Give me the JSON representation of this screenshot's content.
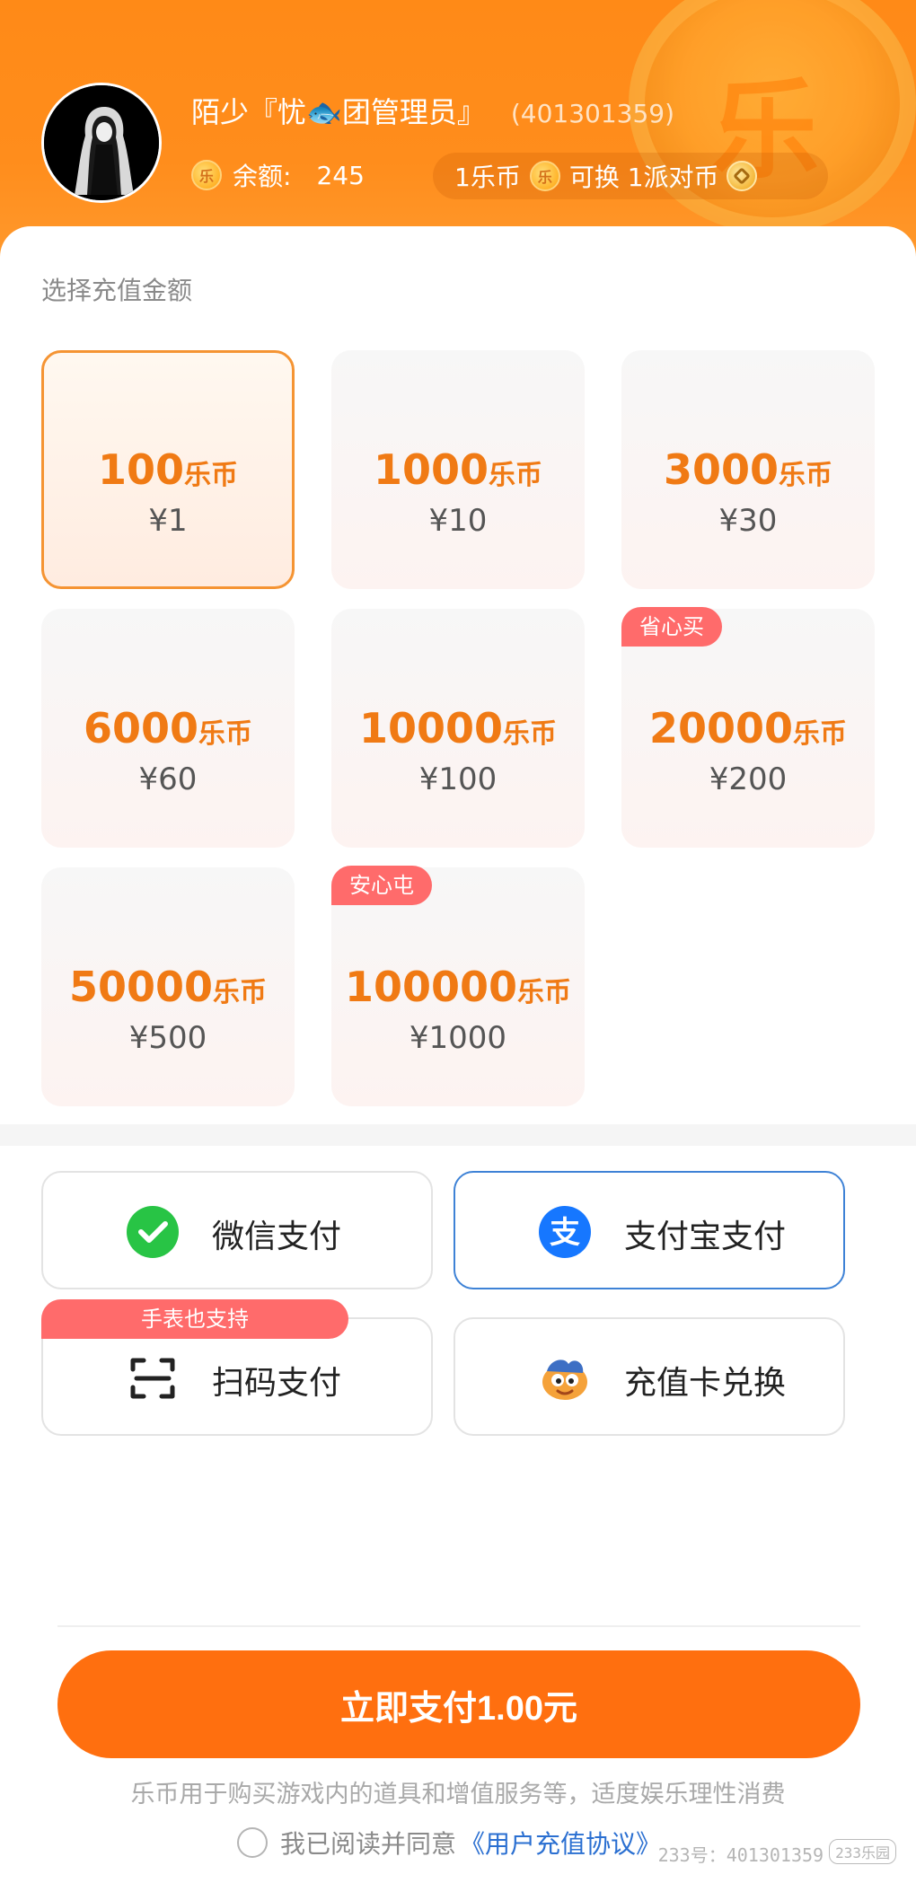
{
  "user": {
    "name": "陌少『忧🐟团管理员』",
    "id": "(401301359)",
    "balance_label": "余额:",
    "balance_value": "245",
    "rate_from": "1乐币",
    "rate_text": "可换 1派对币"
  },
  "recharge": {
    "section_title": "选择充值金额",
    "unit": "乐币",
    "packages": [
      {
        "coins": "100",
        "price": "¥1",
        "selected": true
      },
      {
        "coins": "1000",
        "price": "¥10"
      },
      {
        "coins": "3000",
        "price": "¥30"
      },
      {
        "coins": "6000",
        "price": "¥60"
      },
      {
        "coins": "10000",
        "price": "¥100"
      },
      {
        "coins": "20000",
        "price": "¥200",
        "tag": "省心买"
      },
      {
        "coins": "50000",
        "price": "¥500"
      },
      {
        "coins": "100000",
        "price": "¥1000",
        "tag": "安心屯"
      }
    ]
  },
  "payment": {
    "methods": [
      {
        "label": "微信支付",
        "icon": "wechat-pay-icon"
      },
      {
        "label": "支付宝支付",
        "icon": "alipay-icon",
        "selected": true
      },
      {
        "label": "扫码支付",
        "icon": "scan-icon",
        "tag": "手表也支持"
      },
      {
        "label": "充值卡兑换",
        "icon": "recharge-card-mascot-icon"
      }
    ]
  },
  "footer": {
    "pay_button": "立即支付1.00元",
    "disclaimer": "乐币用于购买游戏内的道具和增值服务等，适度娱乐理性消费",
    "agree_prefix": "我已阅读并同意",
    "agree_link": "《用户充值协议》"
  },
  "watermark": {
    "text": "233号：401301359",
    "logo": "233乐园"
  },
  "colors": {
    "accent": "#ff6f0f",
    "header": "#ff8a17",
    "tag": "#ff6b6b",
    "coin_text": "#f07a14",
    "selected_border": "#3e82d6"
  }
}
